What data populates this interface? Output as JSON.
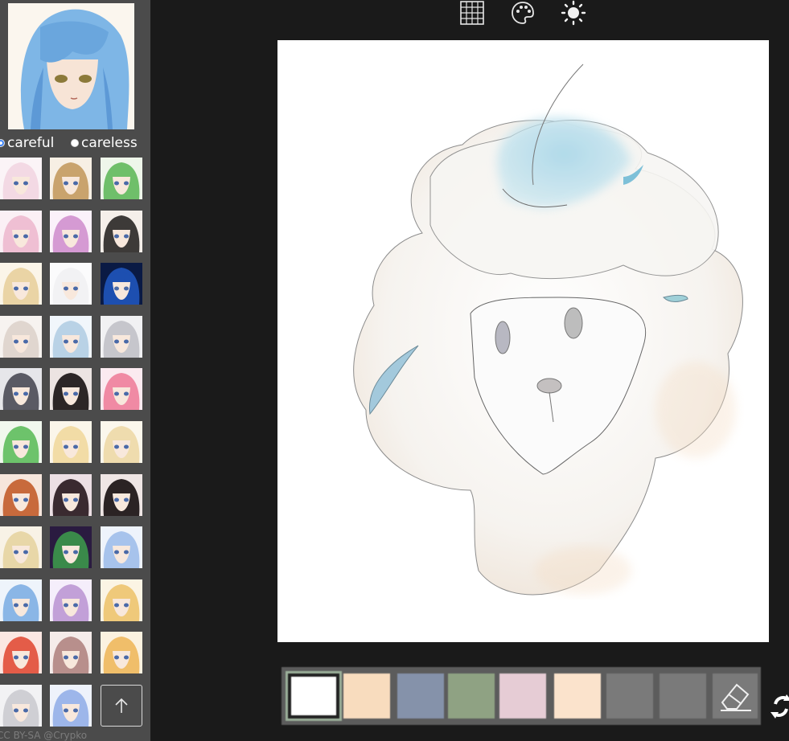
{
  "sidebar": {
    "reference_image": "anime-girl-blue-hair",
    "modes": [
      {
        "label": "careful",
        "selected": true
      },
      {
        "label": "careless",
        "selected": false
      }
    ],
    "thumbnails": [
      {
        "name": "pink-hair",
        "hair": "#f3d9e4",
        "bg": "#fbf4f7"
      },
      {
        "name": "blonde-cat-ears",
        "hair": "#c9a36d",
        "bg": "#f7efe4"
      },
      {
        "name": "green-hair",
        "hair": "#6fbf6a",
        "bg": "#eef6ea"
      },
      {
        "name": "pink-headphones",
        "hair": "#efbfd3",
        "bg": "#fbf0f5"
      },
      {
        "name": "purple-hair",
        "hair": "#d59ad3",
        "bg": "#fbf1fa"
      },
      {
        "name": "dark-short-hair",
        "hair": "#3d3a38",
        "bg": "#f5efea"
      },
      {
        "name": "blonde-fox-ears",
        "hair": "#ead4a5",
        "bg": "#fbf5e9"
      },
      {
        "name": "white-hair",
        "hair": "#f2f2f4",
        "bg": "#fbfbfc"
      },
      {
        "name": "blue-glow",
        "hair": "#1d4fb0",
        "bg": "#0a1a44"
      },
      {
        "name": "platinum-hair",
        "hair": "#e0d6cf",
        "bg": "#f7f3f0"
      },
      {
        "name": "light-blue-hair",
        "hair": "#b9d2e6",
        "bg": "#f1f6fb"
      },
      {
        "name": "silver-hair",
        "hair": "#c6c6cc",
        "bg": "#f1f1f3"
      },
      {
        "name": "gray-wolf",
        "hair": "#5a5a64",
        "bg": "#e6e6ea"
      },
      {
        "name": "black-long-hair",
        "hair": "#2c2626",
        "bg": "#ece4e2"
      },
      {
        "name": "pink-bright",
        "hair": "#f08aa4",
        "bg": "#fbeaf0"
      },
      {
        "name": "green-short",
        "hair": "#6dc36b",
        "bg": "#f1f8ee"
      },
      {
        "name": "blonde-boy",
        "hair": "#f2dca6",
        "bg": "#fbf6ea"
      },
      {
        "name": "blonde-long",
        "hair": "#efdcae",
        "bg": "#fbf7ec"
      },
      {
        "name": "orange-smile",
        "hair": "#c86a3c",
        "bg": "#f6e6dc"
      },
      {
        "name": "dark-pink-bow",
        "hair": "#3a2a30",
        "bg": "#ecdfe4"
      },
      {
        "name": "black-red",
        "hair": "#2b2324",
        "bg": "#efe6e5"
      },
      {
        "name": "blonde-headband",
        "hair": "#e8d7a8",
        "bg": "#f8f2e6"
      },
      {
        "name": "green-purple-split",
        "hair": "#3a8a4a",
        "bg": "#2a1b40"
      },
      {
        "name": "blue-bow",
        "hair": "#a7c3ec",
        "bg": "#eef3fb"
      },
      {
        "name": "blue-hair",
        "hair": "#8ab6e6",
        "bg": "#eef4fb"
      },
      {
        "name": "lavender-hair",
        "hair": "#c2a0d8",
        "bg": "#f5eefb"
      },
      {
        "name": "golden-hair",
        "hair": "#efc97a",
        "bg": "#fbf4e4"
      },
      {
        "name": "red-hair",
        "hair": "#e45c48",
        "bg": "#fbe7e2"
      },
      {
        "name": "brown-pink",
        "hair": "#b88f8c",
        "bg": "#f5ecea"
      },
      {
        "name": "yellow-orange",
        "hair": "#f0be6a",
        "bg": "#fbf2e0"
      },
      {
        "name": "silver-maid",
        "hair": "#cfcfd4",
        "bg": "#f2f2f4"
      },
      {
        "name": "blue-ribbon",
        "hair": "#9db6ea",
        "bg": "#eef2fb"
      }
    ],
    "upload_icon": "upload-arrow-icon",
    "credit": "CC BY-SA @Crypko"
  },
  "toolbar": {
    "icons": [
      "grid-icon",
      "palette-icon",
      "brightness-icon"
    ]
  },
  "palette": {
    "swatches": [
      "#ffffff",
      "#f8dcbe",
      "#8592aa",
      "#8fa283",
      "#e6ccd5",
      "#fbe3cc",
      "#7a7a7a",
      "#7a7a7a",
      "#7a7a7a"
    ],
    "selected_index": 0,
    "eraser_icon": "eraser-icon",
    "rotate_icon": "rotate-icon"
  }
}
